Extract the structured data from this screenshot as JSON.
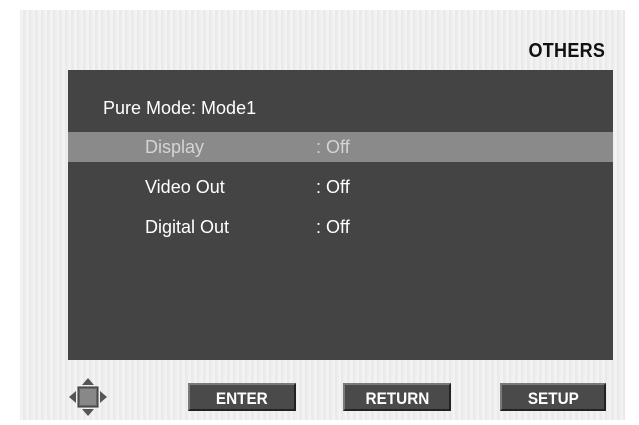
{
  "header": {
    "section_title": "OTHERS"
  },
  "panel": {
    "mode_label": "Pure Mode: Mode1",
    "rows": [
      {
        "label": "Display",
        "separator": ":",
        "value": "Off",
        "selected": true
      },
      {
        "label": "Video Out",
        "separator": ":",
        "value": "Off",
        "selected": false
      },
      {
        "label": "Digital Out",
        "separator": ":",
        "value": "Off",
        "selected": false
      }
    ]
  },
  "footer": {
    "nav_icon": "direction-pad-icon",
    "enter_label": "ENTER",
    "return_label": "RETURN",
    "setup_label": "SETUP"
  },
  "colors": {
    "panel_bg": "#444444",
    "selected_row_bg": "#8a8a8a",
    "button_bg": "#4a4a4a"
  }
}
